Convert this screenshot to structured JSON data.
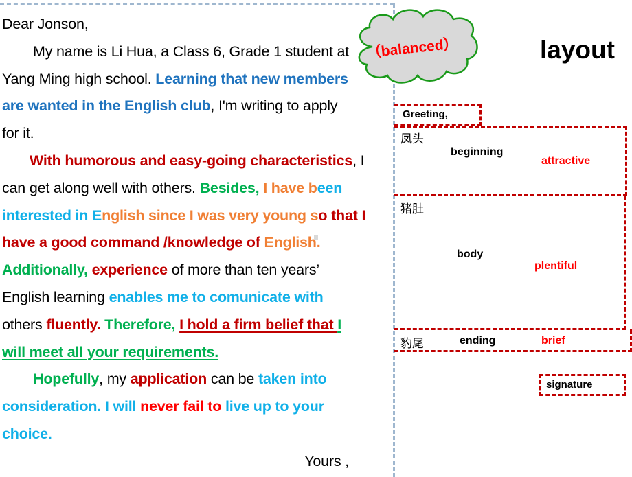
{
  "letter": {
    "salutation": "Dear Jonson,",
    "p1": {
      "intro": "My name is Li Hua, a Class 6, Grade 1 student at",
      "school": "Yang Ming high school. ",
      "purpose_a": "Learning that new members",
      "purpose_b": "are wanted in the English club",
      "apply": ", I'm writing to apply",
      "end": "for it."
    },
    "p2": {
      "s1": "With humorous and easy-going characteristics",
      "s1_tail": ", I",
      "s2": "can get along well with others. ",
      "besides": "Besides, ",
      "have_b": "I have b",
      "een": "een",
      "interested": "interested in E",
      "nglish": "nglish since I was very young s",
      "o_that": "o that I",
      "command": "have a good command /knowledge of ",
      "english": "English.",
      "additionally": "Additionally, ",
      "experience": "experience",
      "years": " of more than ten years’",
      "learning": "English learning ",
      "enables": "enables me to comunicate with",
      "others": "others ",
      "fluently": "fluently. ",
      "therefore": "Therefore, ",
      "belief": "I hold a firm belief that ",
      "belief_i": "I",
      "meet": "will meet all your requirements."
    },
    "p3": {
      "hopefully": "Hopefully",
      "my": ", my ",
      "application": "application",
      "can_be": " can be ",
      "taken": "taken into",
      "consideration": "consideration. I will ",
      "never": "never fail to",
      "live": " live up to your",
      "choice": "choice."
    },
    "closing": "Yours ,"
  },
  "cloud": {
    "label": "（balanced）"
  },
  "layout": {
    "title": "layout",
    "greeting": "Greeting,",
    "beginning": {
      "cn": "凤头",
      "label": "beginning",
      "quality": "attractive"
    },
    "body": {
      "cn": "猪肚",
      "label": "body",
      "quality": "plentiful"
    },
    "ending": {
      "cn": "豹尾",
      "label": "ending",
      "quality": "brief"
    },
    "signature": "signature"
  },
  "colors": {
    "dark_red": "#c00000",
    "red": "#ff0000",
    "blue": "#1f73be",
    "cyan": "#11b0e8",
    "green": "#00b050",
    "orange": "#f07f34",
    "frame": "#9fb7cf",
    "cloud_fill": "#d9d9d9",
    "cloud_stroke": "#1a9a1a"
  }
}
